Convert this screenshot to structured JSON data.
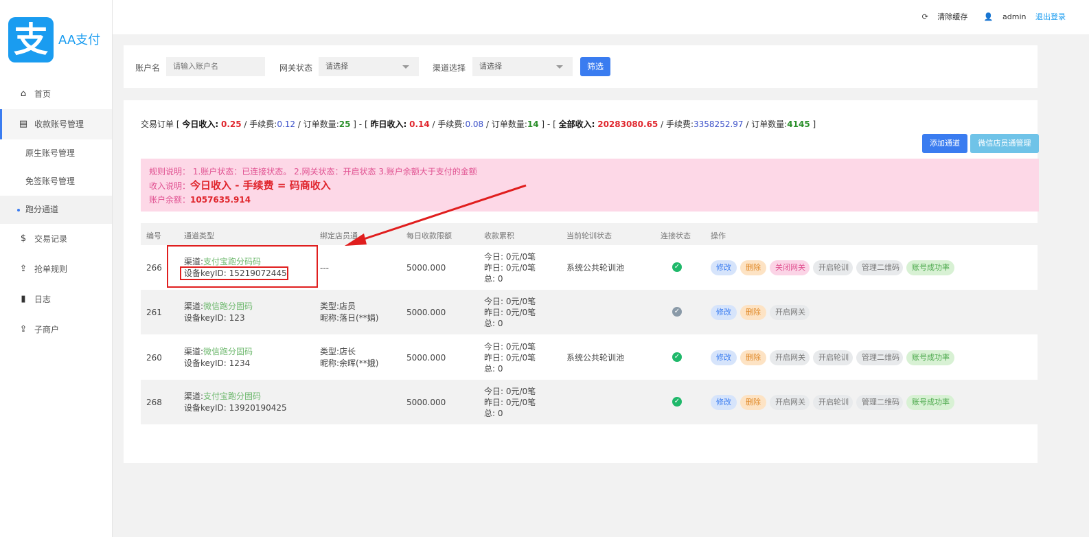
{
  "brand": {
    "logo_glyph": "支",
    "name": "AA支付"
  },
  "topbar": {
    "clear_cache": "清除缓存",
    "user": "admin",
    "logout": "退出登录"
  },
  "sidebar": {
    "items": [
      {
        "icon": "home-icon",
        "label": "首页"
      },
      {
        "icon": "list-icon",
        "label": "收款账号管理"
      },
      {
        "label": "原生账号管理"
      },
      {
        "label": "免签账号管理"
      },
      {
        "label": "跑分通道"
      },
      {
        "icon": "dollar-icon",
        "label": "交易记录"
      },
      {
        "icon": "upload-icon",
        "label": "抢单规则"
      },
      {
        "icon": "book-icon",
        "label": "日志"
      },
      {
        "icon": "upload-icon",
        "label": "子商户"
      }
    ]
  },
  "filter": {
    "account_label": "账户名",
    "account_placeholder": "请输入账户名",
    "gateway_label": "网关状态",
    "gateway_value": "请选择",
    "channel_label": "渠道选择",
    "channel_value": "请选择",
    "submit": "筛选"
  },
  "summary": {
    "prefix": "交易订单 [",
    "today_label": "今日收入:",
    "today_income": "0.25",
    "fee_label": "/ 手续费:",
    "today_fee": "0.12",
    "count_label": "/ 订单数量:",
    "today_count": "25",
    "sep1": "] - [",
    "yest_label": "昨日收入:",
    "yest_income": "0.14",
    "yest_fee": "0.08",
    "yest_count": "14",
    "sep2": "] - [",
    "all_label": "全部收入:",
    "all_income": "20283080.65",
    "all_fee": "3358252.97",
    "all_count": "4145",
    "suffix": "]"
  },
  "buttons": {
    "add_channel": "添加通道",
    "wx_manage": "微信店员通管理"
  },
  "notice": {
    "rules": "规则说明： 1.账户状态：已连接状态。 2.网关状态：开启状态 3.账户余额大于支付的金额",
    "income_label": "收入说明：",
    "income_formula": "今日收入 - 手续费 = 码商收入",
    "balance_label": "账户余额：",
    "balance": "1057635.914"
  },
  "table": {
    "headers": [
      "编号",
      "通道类型",
      "绑定店员通",
      "每日收款限额",
      "收款累积",
      "当前轮训状态",
      "连接状态",
      "操作"
    ],
    "rows": [
      {
        "id": "266",
        "channel_prefix": "渠道:",
        "channel": "支付宝跑分码码",
        "key_label": "设备keyID:",
        "key": "15219072445",
        "clerk_line1": "---",
        "clerk_line2": "",
        "limit": "5000.000",
        "acc1": "今日: 0元/0笔",
        "acc2": "昨日: 0元/0笔",
        "acc3": "总: 0",
        "poll": "系统公共轮训池",
        "connected": true,
        "ops": [
          "修改",
          "删除",
          "关闭网关",
          "开启轮训",
          "管理二维码",
          "账号成功率"
        ]
      },
      {
        "id": "261",
        "channel_prefix": "渠道:",
        "channel": "微信跑分固码",
        "key_label": "设备keyID:",
        "key": "123",
        "clerk_line1": "类型:店员",
        "clerk_line2": "昵称:落日(**娟)",
        "limit": "5000.000",
        "acc1": "今日: 0元/0笔",
        "acc2": "昨日: 0元/0笔",
        "acc3": "总: 0",
        "poll": "",
        "connected": false,
        "ops": [
          "修改",
          "删除",
          "开启网关"
        ]
      },
      {
        "id": "260",
        "channel_prefix": "渠道:",
        "channel": "微信跑分固码",
        "key_label": "设备keyID:",
        "key": "1234",
        "clerk_line1": "类型:店长",
        "clerk_line2": "昵称:余晖(**娥)",
        "limit": "5000.000",
        "acc1": "今日: 0元/0笔",
        "acc2": "昨日: 0元/0笔",
        "acc3": "总: 0",
        "poll": "系统公共轮训池",
        "connected": true,
        "ops": [
          "修改",
          "删除",
          "开启网关",
          "开启轮训",
          "管理二维码",
          "账号成功率"
        ]
      },
      {
        "id": "268",
        "channel_prefix": "渠道:",
        "channel": "支付宝跑分固码",
        "key_label": "设备keyID:",
        "key": "13920190425",
        "clerk_line1": "",
        "clerk_line2": "",
        "limit": "5000.000",
        "acc1": "今日: 0元/0笔",
        "acc2": "昨日: 0元/0笔",
        "acc3": "总: 0",
        "poll": "",
        "connected": true,
        "ops": [
          "修改",
          "删除",
          "开启网关",
          "开启轮训",
          "管理二维码",
          "账号成功率"
        ]
      }
    ]
  },
  "colors": {
    "accent": "#3a7cf0",
    "brand": "#1a9cf0",
    "notice_bg": "#fdd8e7",
    "income_red": "#e0262d",
    "annotation": "#e01e1e"
  }
}
